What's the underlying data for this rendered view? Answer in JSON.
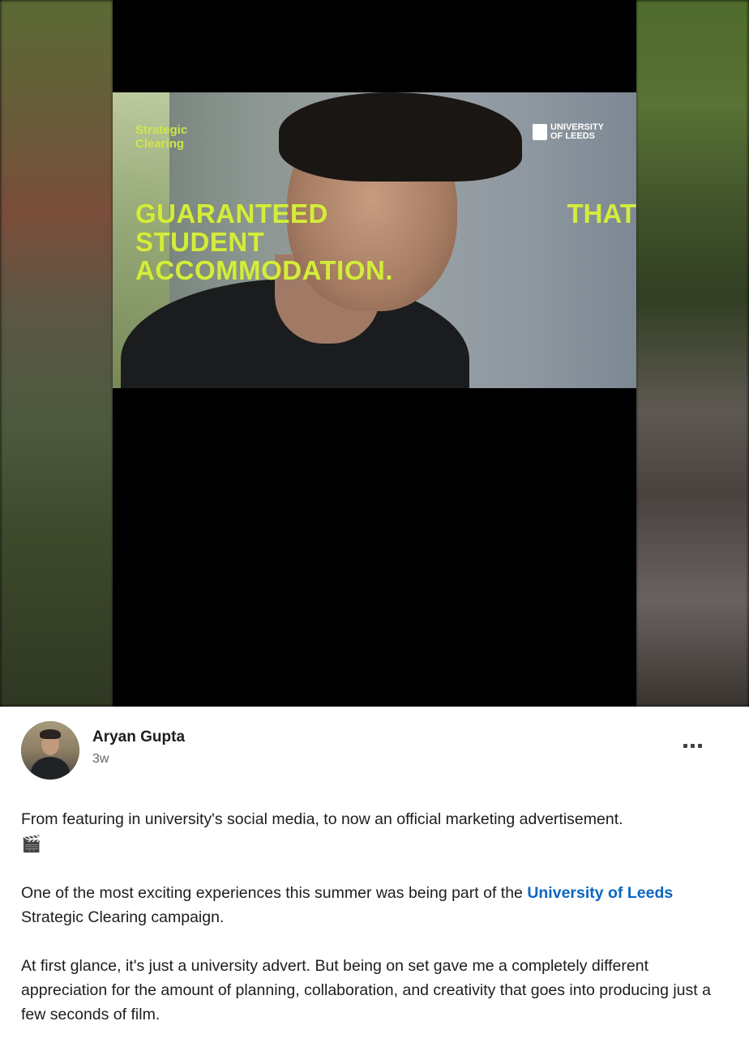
{
  "video": {
    "overlay_small_line1": "Strategic",
    "overlay_small_line2": "Clearing",
    "overlay_big_line1": "GUARANTEED",
    "overlay_big_line2": "STUDENT",
    "overlay_big_line3": "ACCOMMODATION.",
    "overlay_that": "THAT",
    "logo_line1": "UNIVERSITY",
    "logo_line2": "OF LEEDS",
    "accent_color": "#d4ec3c"
  },
  "post": {
    "author_name": "Aryan Gupta",
    "time_ago": "3w",
    "more_icon": "more-options-icon",
    "paragraph1": "From featuring in university's social media, to now an official marketing advertisement.",
    "paragraph1_emoji": "🎬",
    "paragraph2_before": "One of the most exciting experiences this summer was being part of the ",
    "paragraph2_mention": "University of Leeds",
    "paragraph2_after": " Strategic Clearing campaign.",
    "paragraph3": "At first glance, it's just a university advert. But being on set gave me a completely different appreciation for the amount of planning, collaboration, and creativity that goes into producing just a few seconds of film.",
    "mention_color": "#0a66c2"
  }
}
